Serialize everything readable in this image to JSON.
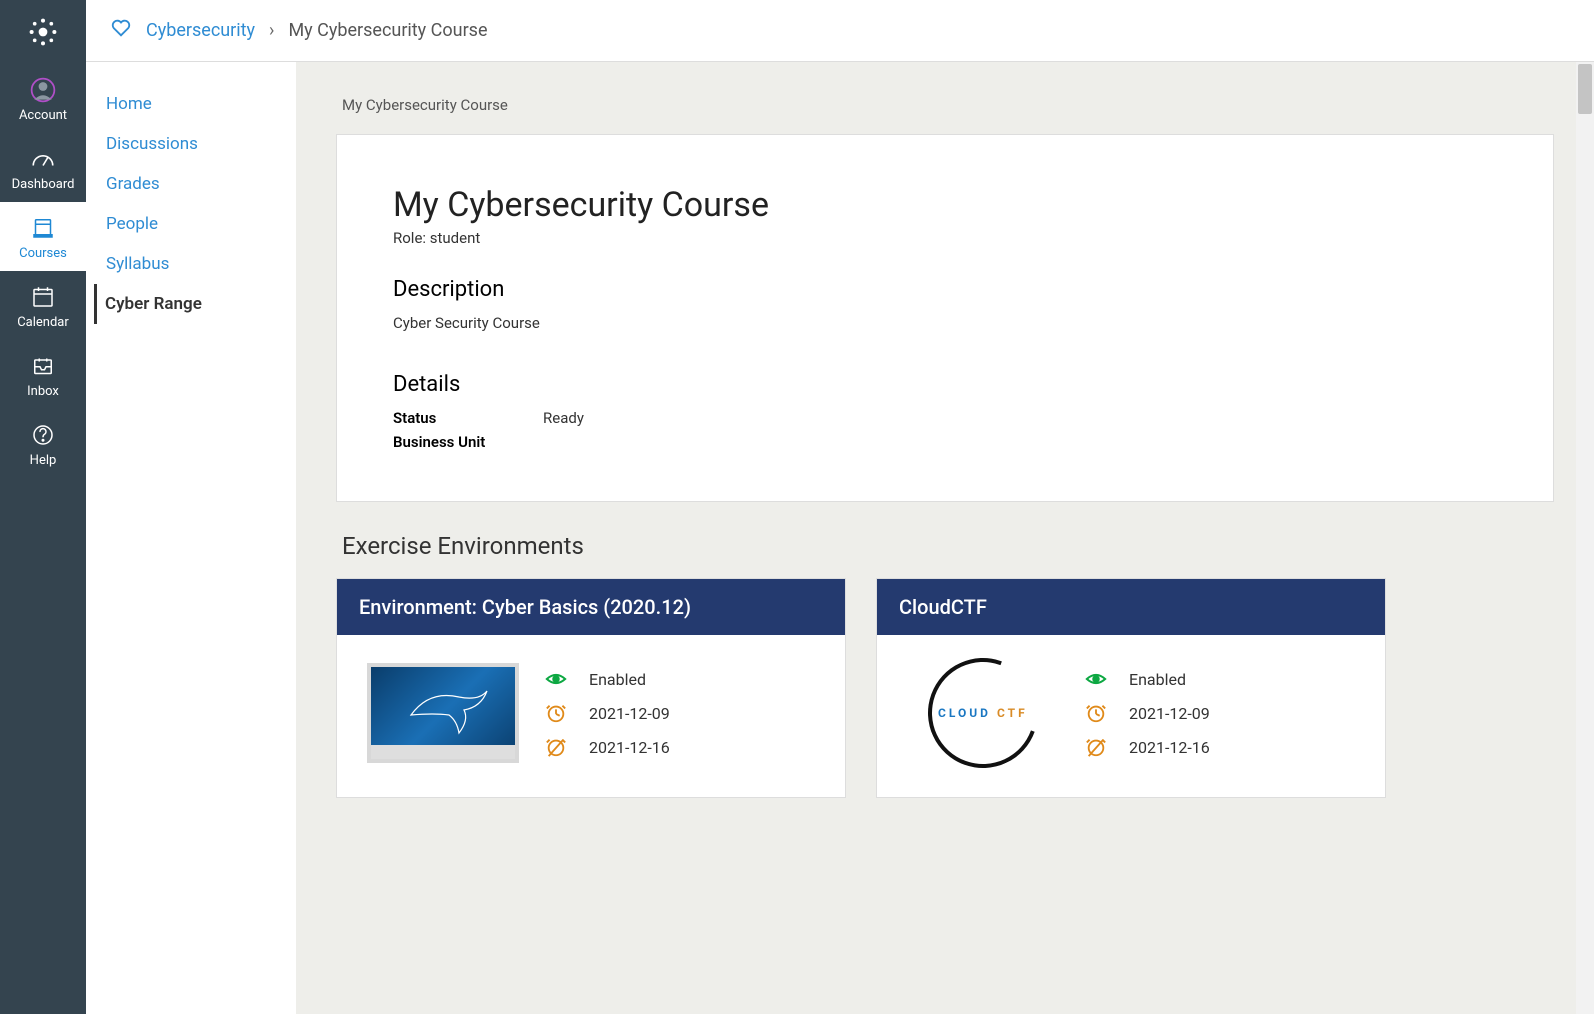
{
  "rail": {
    "items": [
      {
        "label": "Account",
        "icon": "account-icon"
      },
      {
        "label": "Dashboard",
        "icon": "dashboard-icon"
      },
      {
        "label": "Courses",
        "icon": "courses-icon",
        "active": true
      },
      {
        "label": "Calendar",
        "icon": "calendar-icon"
      },
      {
        "label": "Inbox",
        "icon": "inbox-icon"
      },
      {
        "label": "Help",
        "icon": "help-icon"
      }
    ]
  },
  "breadcrumb": {
    "root": "Cybersecurity",
    "sep": "›",
    "current": "My Cybersecurity Course"
  },
  "leftnav": {
    "items": [
      {
        "label": "Home"
      },
      {
        "label": "Discussions"
      },
      {
        "label": "Grades"
      },
      {
        "label": "People"
      },
      {
        "label": "Syllabus"
      },
      {
        "label": "Cyber Range",
        "active": true
      }
    ]
  },
  "context_title": "My Cybersecurity Course",
  "card": {
    "title": "My Cybersecurity Course",
    "role_line": "Role: student",
    "desc_heading": "Description",
    "desc_value": "Cyber Security Course",
    "details_heading": "Details",
    "rows": [
      {
        "k": "Status",
        "v": "Ready"
      },
      {
        "k": "Business Unit",
        "v": ""
      }
    ]
  },
  "exercise": {
    "heading": "Exercise Environments",
    "cards": [
      {
        "title": "Environment: Cyber Basics (2020.12)",
        "thumb": "kali",
        "status": "Enabled",
        "start": "2021-12-09",
        "end": "2021-12-16"
      },
      {
        "title": "CloudCTF",
        "thumb": "cloudctf",
        "status": "Enabled",
        "start": "2021-12-09",
        "end": "2021-12-16"
      }
    ]
  }
}
